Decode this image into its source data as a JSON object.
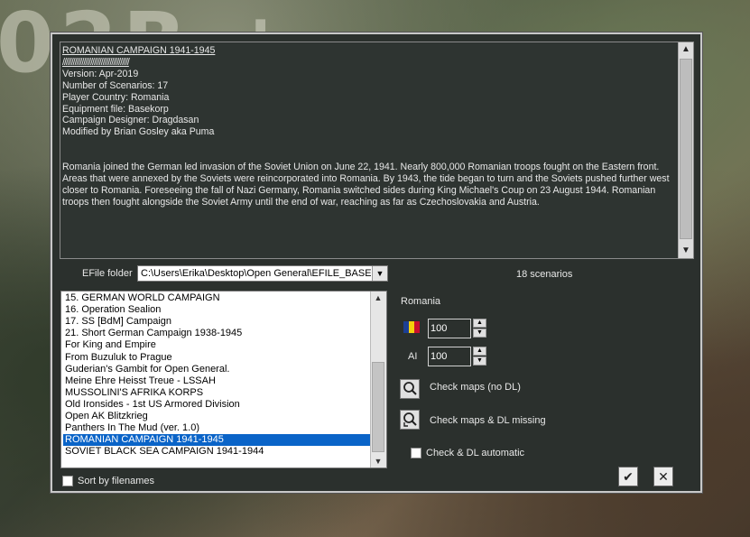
{
  "info": {
    "title": "ROMANIAN CAMPAIGN 1941-1945",
    "hatch": "//////////////////////////////////////",
    "version": "Version:  Apr-2019",
    "num_scenarios": "Number of Scenarios: 17",
    "player_country": "Player Country: Romania",
    "equipment": "Equipment file: Basekorp",
    "designer": "Campaign Designer: Dragdasan",
    "modified": "Modified by Brian Gosley aka Puma",
    "description": "Romania joined the German led invasion of the Soviet Union on June 22, 1941. Nearly 800,000 Romanian troops fought on the Eastern front. Areas that were annexed by the Soviets were reincorporated into Romania. By 1943, the tide began to turn and the Soviets pushed further west closer to Romania. Foreseeing the fall of Nazi Germany, Romania switched sides during King Michael's Coup on 23 August 1944. Romanian troops then fought alongside the Soviet Army until the end of war, reaching as far as Czechoslovakia and Austria."
  },
  "efile": {
    "label": "EFile folder",
    "value": "C:\\Users\\Erika\\Desktop\\Open General\\EFILE_BASE"
  },
  "scenario_count": "18 scenarios",
  "campaigns": {
    "items": [
      "15.  GERMAN WORLD CAMPAIGN",
      "16. Operation Sealion",
      "17. SS [BdM] Campaign",
      "21. Short German Campaign 1938-1945",
      "For King and Empire",
      "From Buzuluk to Prague",
      "Guderian's Gambit for Open General.",
      "Meine Ehre Heisst Treue - LSSAH",
      "MUSSOLINI'S AFRIKA KORPS",
      "Old Ironsides - 1st US Armored Division",
      "Open AK Blitzkrieg",
      "Panthers In The Mud (ver. 1.0)",
      "ROMANIAN CAMPAIGN 1941-1945",
      "SOVIET BLACK SEA CAMPAIGN 1941-1944"
    ],
    "selected_index": 12
  },
  "sort": {
    "label": "Sort by filenames",
    "checked": false
  },
  "player": {
    "country": "Romania",
    "player_value": "100",
    "ai_label": "AI",
    "ai_value": "100"
  },
  "flag_colors": [
    "#1c3f94",
    "#f5d00b",
    "#c8102e"
  ],
  "actions": {
    "check_maps": "Check maps (no DL)",
    "check_maps_dl": "Check maps & DL missing",
    "check_dl_auto": "Check & DL automatic"
  },
  "icons": {
    "check_maps": "magnifier-icon",
    "check_maps_dl": "magnifier-download-icon",
    "ok": "checkmark-icon",
    "cancel": "close-icon"
  }
}
